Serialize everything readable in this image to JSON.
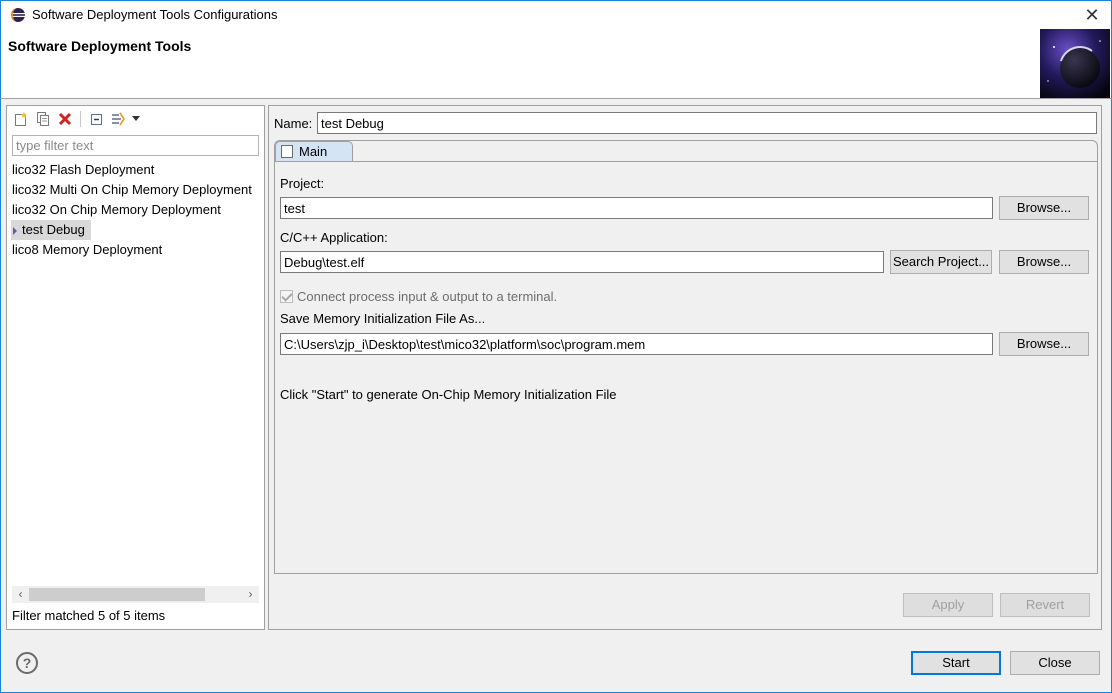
{
  "window": {
    "title": "Software Deployment Tools Configurations",
    "close_glyph": "✕"
  },
  "banner": {
    "heading": "Software Deployment Tools"
  },
  "left_panel": {
    "toolbar": {
      "icons": [
        "new-config-icon",
        "duplicate-icon",
        "delete-icon",
        "collapse-all-icon",
        "filter-icon",
        "dropdown-arrow-icon"
      ]
    },
    "filter": {
      "placeholder": "type filter text",
      "value": ""
    },
    "items": [
      {
        "label": "lico32 Flash Deployment"
      },
      {
        "label": "lico32 Multi On Chip Memory Deployment"
      },
      {
        "label": "lico32 On Chip Memory Deployment"
      },
      {
        "label": "test Debug",
        "selected": true
      },
      {
        "label": "lico8 Memory Deployment"
      }
    ],
    "scroll_left": "‹",
    "scroll_right": "›",
    "status": "Filter matched 5 of 5 items"
  },
  "right_panel": {
    "name_label": "Name:",
    "name_value": "test Debug",
    "tab": "Main",
    "project_label": "Project:",
    "project_value": "test",
    "project_browse": "Browse...",
    "app_label": "C/C++ Application:",
    "app_value": "Debug\\test.elf",
    "search_project": "Search Project...",
    "app_browse": "Browse...",
    "connect_label": "Connect process input & output to a terminal.",
    "save_label": "Save Memory Initialization File As...",
    "save_value": "C:\\Users\\zjp_i\\Desktop\\test\\mico32\\platform\\soc\\program.mem",
    "save_browse": "Browse...",
    "info_text": "Click \"Start\" to generate On-Chip Memory Initialization File",
    "apply": "Apply",
    "revert": "Revert"
  },
  "footer": {
    "help_glyph": "?",
    "start": "Start",
    "close": "Close"
  },
  "colors": {
    "accent": "#0078d7",
    "window_frame": "#1883d7",
    "selected_bg": "#d9d9d9",
    "tab_bg": "#d4e4f4"
  }
}
